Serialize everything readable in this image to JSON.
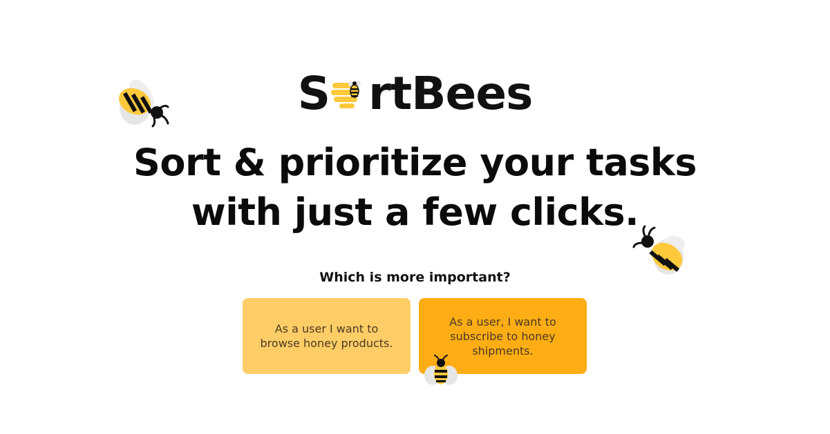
{
  "logo": {
    "before": "S",
    "after": "rtBees"
  },
  "headline": {
    "line1": "Sort & prioritize your tasks",
    "line2": "with just a few clicks."
  },
  "prompt": "Which is more important?",
  "options": [
    {
      "text": "As a user I want to browse honey products."
    },
    {
      "text": "As a user, I want to subscribe to honey shipments."
    }
  ],
  "colors": {
    "option_light": "#ffcd66",
    "option_dark": "#ffad14",
    "text_dark": "#0b0b0b",
    "bee_yellow": "#ffc93c",
    "bee_wing": "#e8e8e8"
  },
  "icons": [
    "bee-icon",
    "honeycomb-bee-icon"
  ]
}
